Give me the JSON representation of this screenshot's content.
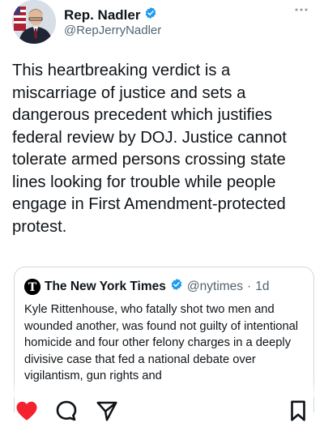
{
  "author": {
    "name": "Rep. Nadler",
    "handle": "@RepJerryNadler",
    "verified": true
  },
  "tweet": {
    "text": "This heartbreaking verdict is a miscarriage of justice and sets a dangerous precedent which justifies federal review by DOJ. Justice cannot tolerate armed persons crossing state lines looking for trouble while people engage in First Amendment-protected protest."
  },
  "quoted": {
    "name": "The New York Times",
    "handle": "@nytimes",
    "separator": "·",
    "time": "1d",
    "text": "Kyle Rittenhouse, who fatally shot two men and wounded another, was found not guilty of intentional homicide and four other felony charges in a deeply divisive case that fed a national debate over vigilantism, gun rights and"
  },
  "icons": {
    "more": "more-icon",
    "verified": "verified-badge-icon",
    "like": "heart-icon",
    "reply": "reply-icon",
    "share": "send-icon",
    "bookmark": "bookmark-icon",
    "nyt_logo": "nyt-logo-icon"
  },
  "colors": {
    "like": "#f4212e",
    "verified": "#1d9bf0",
    "secondary_text": "#536471",
    "border": "#cfd9de"
  }
}
